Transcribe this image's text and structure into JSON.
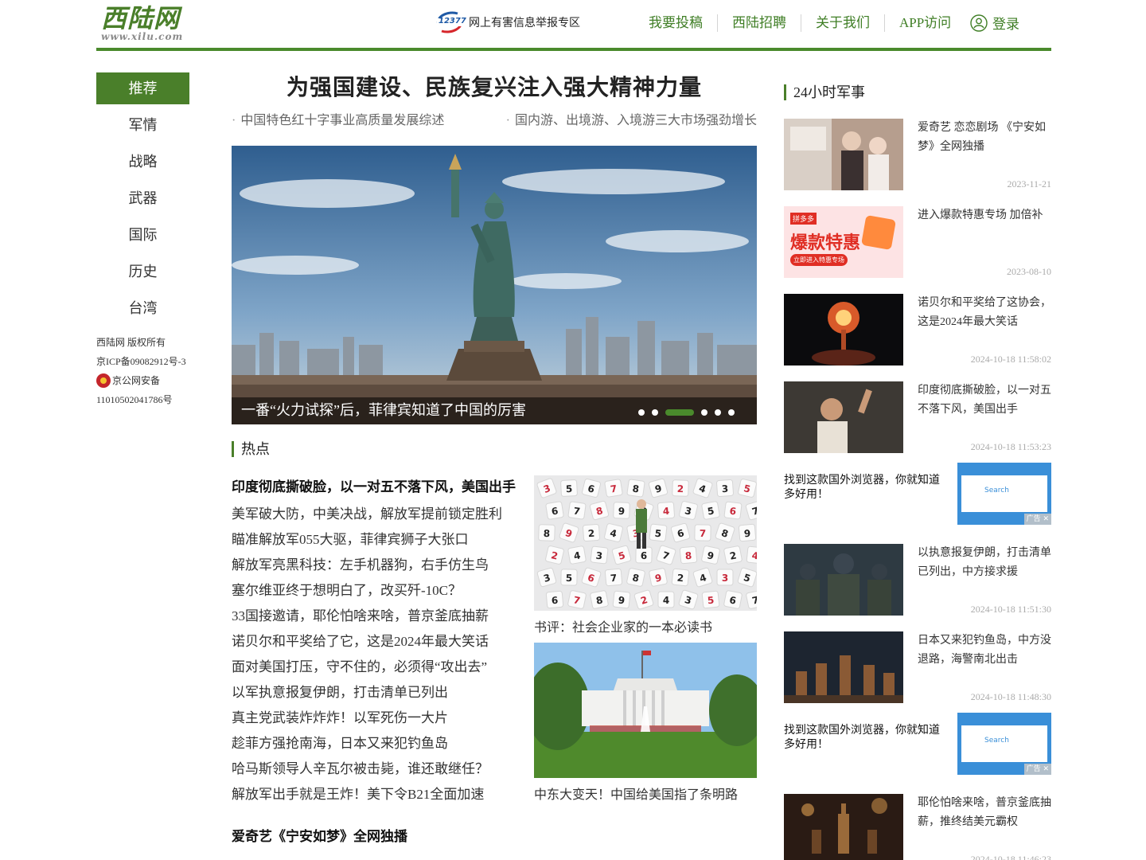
{
  "header": {
    "logo_main": "西陆网",
    "logo_sub": "www.xilu.com",
    "report_badge": "12377",
    "report_text": "网上有害信息举报专区",
    "nav": [
      "我要投稿",
      "西陆招聘",
      "关于我们",
      "APP访问"
    ],
    "login": "登录"
  },
  "leftnav": {
    "items": [
      "推荐",
      "军情",
      "战略",
      "武器",
      "国际",
      "历史",
      "台湾"
    ],
    "active": 0
  },
  "copyright": {
    "line1": "西陆网  版权所有",
    "line2": "京ICP备09082912号-3",
    "line3": "京公网安备",
    "line4": "11010502041786号"
  },
  "main": {
    "headline": "为强国建设、民族复兴注入强大精神力量",
    "subheads": [
      "中国特色红十字事业高质量发展综述",
      "国内游、出境游、入境游三大市场强劲增长"
    ],
    "slider": {
      "caption": "一番“火力试探”后，菲律宾知道了中国的厉害",
      "dot_count": 6,
      "active_dot": 2
    },
    "hot": {
      "title": "热点",
      "lead": "印度彻底撕破脸，以一对五不落下风，美国出手",
      "items": [
        "美军破大防，中美决战，解放军提前锁定胜利",
        "瞄准解放军055大驱，菲律宾狮子大张口",
        "解放军亮黑科技：左手机器狗，右手仿生鸟",
        "塞尔维亚终于想明白了，改买歼-10C？",
        "33国接邀请，耶伦怕啥来啥，普京釜底抽薪",
        "诺贝尔和平奖给了它，这是2024年最大笑话",
        "面对美国打压，守不住的，必须得“攻出去”",
        "以军执意报复伊朗，打击清单已列出",
        "真主党武装炸炸炸！以军死伤一大片",
        "趁菲方强抢南海，日本又来犯钓鱼岛",
        "哈马斯领导人辛瓦尔被击毙，谁还敢继任？",
        "解放军出手就是王炸！美下令B21全面加速"
      ],
      "lead2": "爱奇艺《宁安如梦》全网独播",
      "pic_captions": [
        "书评：社会企业家的一本必读书",
        "中东大变天！中国给美国指了条明路"
      ]
    }
  },
  "right": {
    "title": "24小时军事",
    "news": [
      {
        "title": "爱奇艺 恋恋剧场 《宁安如梦》全网独播",
        "date": "2023-11-21"
      },
      {
        "title": "进入爆款特惠专场 加倍补",
        "date": "2023-08-10",
        "thumb_text": "爆款特惠",
        "thumb_brand": "拼多多",
        "thumb_btn": "立即进入特惠专场"
      },
      {
        "title": "诺贝尔和平奖给了这协会，这是2024年最大笑话",
        "date": "2024-10-18 11:58:02"
      },
      {
        "title": "印度彻底撕破脸，以一对五不落下风，美国出手",
        "date": "2024-10-18 11:53:23"
      },
      {
        "title": "以执意报复伊朗，打击清单已列出，中方接求援",
        "date": "2024-10-18 11:51:30"
      },
      {
        "title": "日本又来犯钓鱼岛，中方没退路，海警南北出击",
        "date": "2024-10-18 11:48:30"
      },
      {
        "title": "耶伦怕啥来啥，普京釜底抽薪，推终结美元霸权",
        "date": "2024-10-18 11:46:23"
      }
    ],
    "ads": [
      {
        "text": "找到这款国外浏览器，你就知道多好用！",
        "img_text": "Search",
        "mark": "广告"
      },
      {
        "text": "找到这款国外浏览器，你就知道多好用！",
        "img_text": "Search",
        "mark": "广告"
      }
    ]
  }
}
